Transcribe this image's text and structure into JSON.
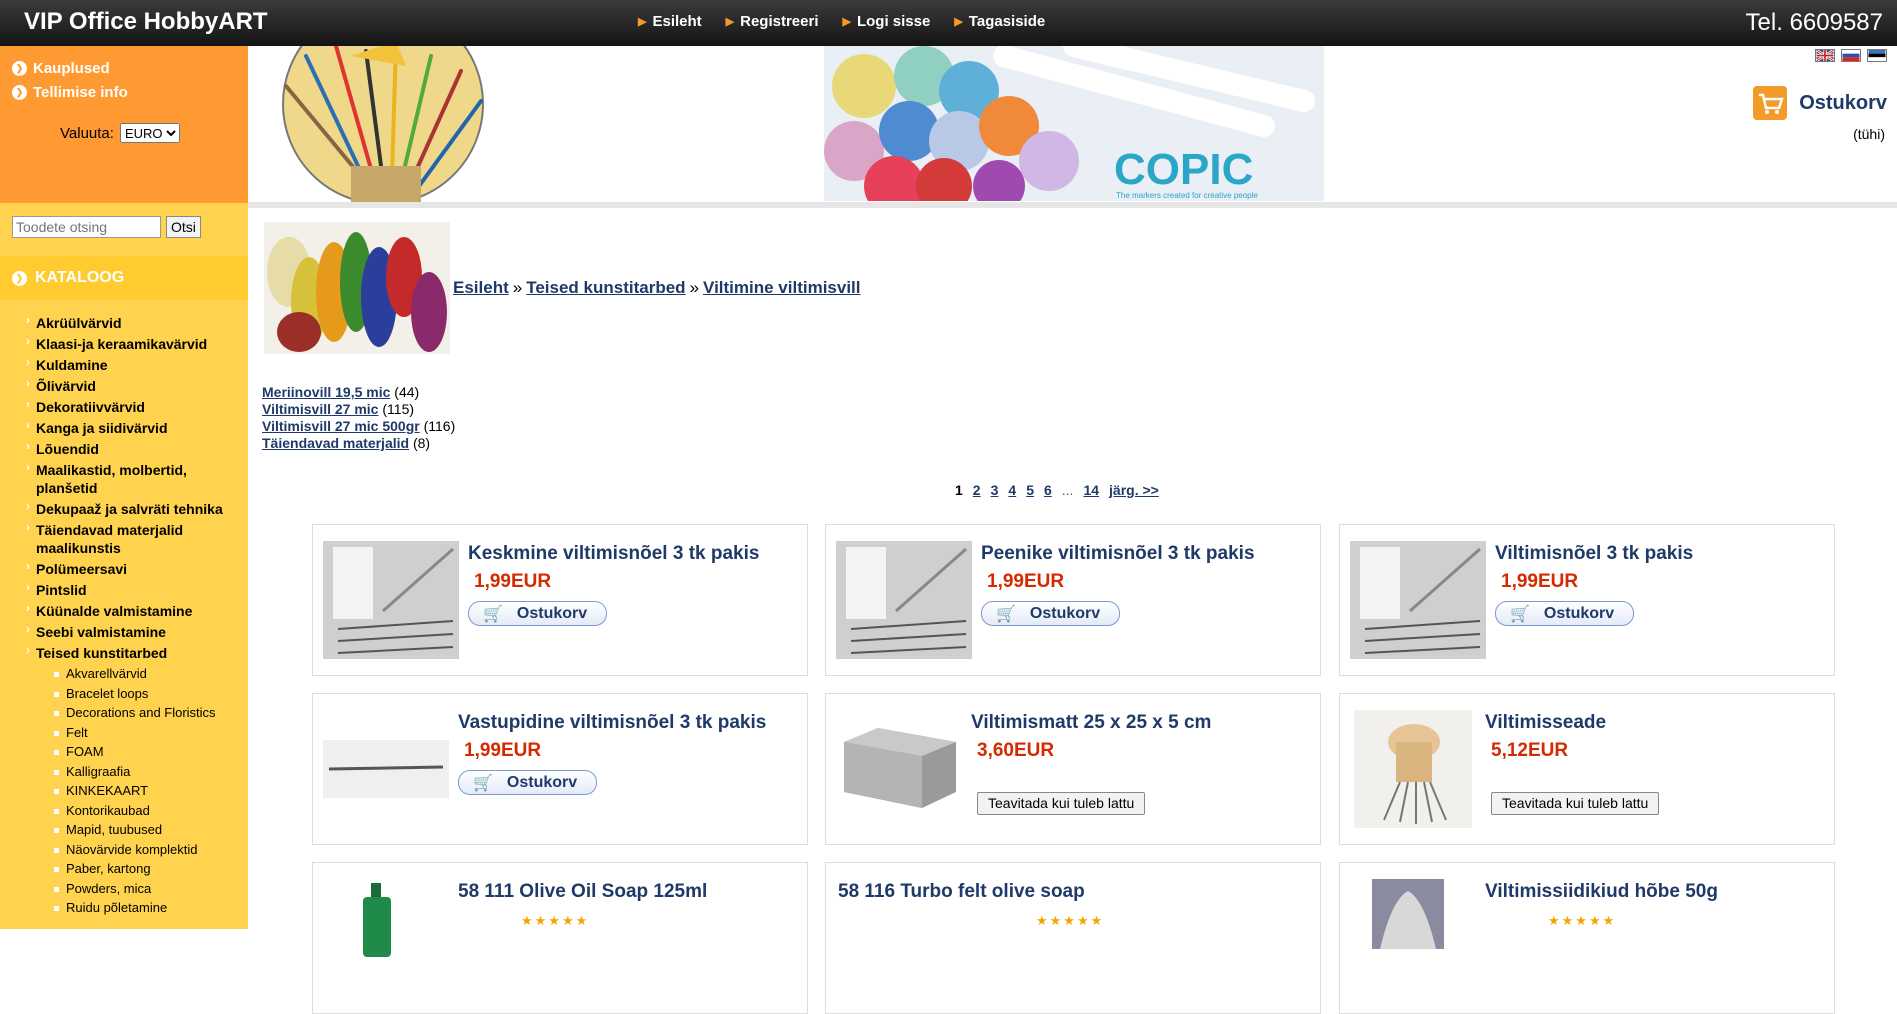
{
  "header": {
    "brand": "VIP Office HobbyART",
    "nav": [
      "Esileht",
      "Registreeri",
      "Logi sisse",
      "Tagasiside"
    ],
    "phone": "Tel. 6609587"
  },
  "sidebar": {
    "links": [
      "Kauplused",
      "Tellimise info"
    ],
    "currency_label": "Valuuta:",
    "currency_value": "EURO",
    "search_placeholder": "Toodete otsing",
    "search_button": "Otsi",
    "catalog_title": "KATALOOG",
    "categories": [
      "Akrüülvärvid",
      "Klaasi-ja keraamikavärvid",
      "Kuldamine",
      "Õlivärvid",
      "Dekoratiivvärvid",
      "Kanga ja siidivärvid",
      "Lõuendid",
      "Maalikastid, molbertid, planšetid",
      "Dekupaaž ja salvräti tehnika",
      "Täiendavad materjalid maalikunstis",
      "Polümeersavi",
      "Pintslid",
      "Küünalde valmistamine",
      "Seebi valmistamine",
      "Teised kunstitarbed"
    ],
    "subcategories": [
      "Akvarellvärvid",
      "Bracelet loops",
      "Decorations and Floristics",
      "Felt",
      "FOAM",
      "Kalligraafia",
      "KINKEKAART",
      "Kontorikaubad",
      "Mapid, tuubused",
      "Näovärvide komplektid",
      "Paber, kartong",
      "Powders, mica",
      "Ruidu põletamine"
    ]
  },
  "banner": {
    "copic_text": "COPIC",
    "copic_tagline": "The markers created for creative people",
    "cart_label": "Ostukorv",
    "cart_status": "(tühi)"
  },
  "breadcrumb": {
    "items": [
      "Esileht",
      "Teised kunstitarbed",
      "Viltimine viltimisvill"
    ]
  },
  "subcategory_links": [
    {
      "name": "Meriinovill 19,5 mic",
      "count": "(44)"
    },
    {
      "name": "Viltimisvill 27 mic",
      "count": "(115)"
    },
    {
      "name": "Viltimisvill 27 mic 500gr",
      "count": "(116)"
    },
    {
      "name": "Täiendavad materjalid",
      "count": "(8)"
    }
  ],
  "pager": {
    "current": "1",
    "pages": [
      "2",
      "3",
      "4",
      "5",
      "6"
    ],
    "dots": "...",
    "last": "14",
    "next": "järg. >>"
  },
  "products": [
    {
      "name": "Keskmine viltimisnõel 3 tk pakis",
      "price": "1,99EUR",
      "action": "Ostukorv"
    },
    {
      "name": "Peenike viltimisnõel 3 tk pakis",
      "price": "1,99EUR",
      "action": "Ostukorv"
    },
    {
      "name": "Viltimisnõel 3 tk pakis",
      "price": "1,99EUR",
      "action": "Ostukorv"
    },
    {
      "name": "Vastupidine viltimisnõel 3 tk pakis",
      "price": "1,99EUR",
      "action": "Ostukorv"
    },
    {
      "name": "Viltimismatt 25 x 25 x 5 cm",
      "price": "3,60EUR",
      "action": "Teavitada kui tuleb lattu"
    },
    {
      "name": "Viltimisseade",
      "price": "5,12EUR",
      "action": "Teavitada kui tuleb lattu"
    },
    {
      "name": "58 111 Olive Oil Soap 125ml",
      "rating": "★★★★★"
    },
    {
      "name": "58 116 Turbo felt olive soap",
      "rating": "★★★★★"
    },
    {
      "name": "Viltimissiidikiud hõbe 50g",
      "rating": "★★★★★"
    }
  ]
}
